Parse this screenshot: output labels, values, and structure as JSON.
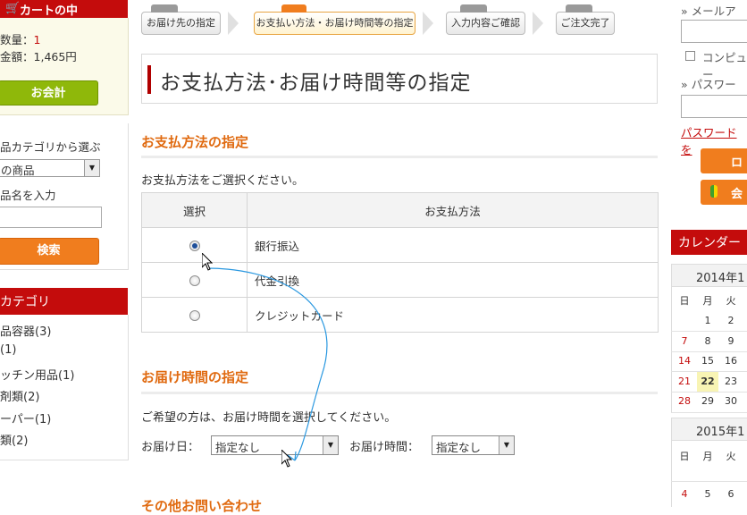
{
  "left": {
    "cart_title": "カートの中",
    "qty_label": "数量：",
    "qty_value": "1",
    "amount_label": "金額：",
    "amount_value": "1,465円",
    "checkout_button": "お会計",
    "cat_select_label": "品カテゴリから選ぶ",
    "cat_select_value": "の商品",
    "name_label": "品名を入力",
    "search_button": "検索",
    "category_title": "カテゴリ",
    "categories": [
      "品容器(3)",
      "(1)",
      "ッチン用品(1)",
      "剤類(2)",
      "ーパー(1)",
      "類(2)"
    ]
  },
  "steps": [
    {
      "label": "お届け先の指定",
      "active": false
    },
    {
      "label": "お支払い方法・お届け時間等の指定",
      "active": true
    },
    {
      "label": "入力内容ご確認",
      "active": false
    },
    {
      "label": "ご注文完了",
      "active": false
    }
  ],
  "page_title": "お支払方法･お届け時間等の指定",
  "payment": {
    "heading": "お支払方法の指定",
    "description": "お支払方法をご選択ください。",
    "col_select": "選択",
    "col_method": "お支払方法",
    "methods": [
      {
        "name": "銀行振込",
        "selected": true
      },
      {
        "name": "代金引換",
        "selected": false
      },
      {
        "name": "クレジットカード",
        "selected": false
      }
    ]
  },
  "delivery": {
    "heading": "お届け時間の指定",
    "description": "ご希望の方は、お届け時間を選択してください。",
    "date_label": "お届け日：",
    "date_value": "指定なし",
    "time_label": "お届け時間：",
    "time_value": "指定なし"
  },
  "other": {
    "heading": "その他お問い合わせ"
  },
  "right": {
    "email_label": "» メールア",
    "remember_label": "コンピュー",
    "password_label": "» パスワード",
    "forgot_link": "パスワードを",
    "login_button": "ロ",
    "register_button": "会",
    "calendar_title": "カレンダー",
    "month1": "2014年1",
    "weekdays": [
      "日",
      "月",
      "火"
    ],
    "month1_rows": [
      [
        "",
        "1",
        "2"
      ],
      [
        "7",
        "8",
        "9"
      ],
      [
        "14",
        "15",
        "16"
      ],
      [
        "21",
        "22",
        "23"
      ],
      [
        "28",
        "29",
        "30"
      ]
    ],
    "today": "22",
    "month2": "2015年1",
    "month2_rows": [
      [
        "",
        "",
        ""
      ],
      [
        "4",
        "5",
        "6"
      ]
    ]
  },
  "colors": {
    "brand_red": "#c40c0c",
    "accent_orange": "#f07d1e",
    "heading_orange": "#e06a10",
    "green": "#8fb80a"
  }
}
